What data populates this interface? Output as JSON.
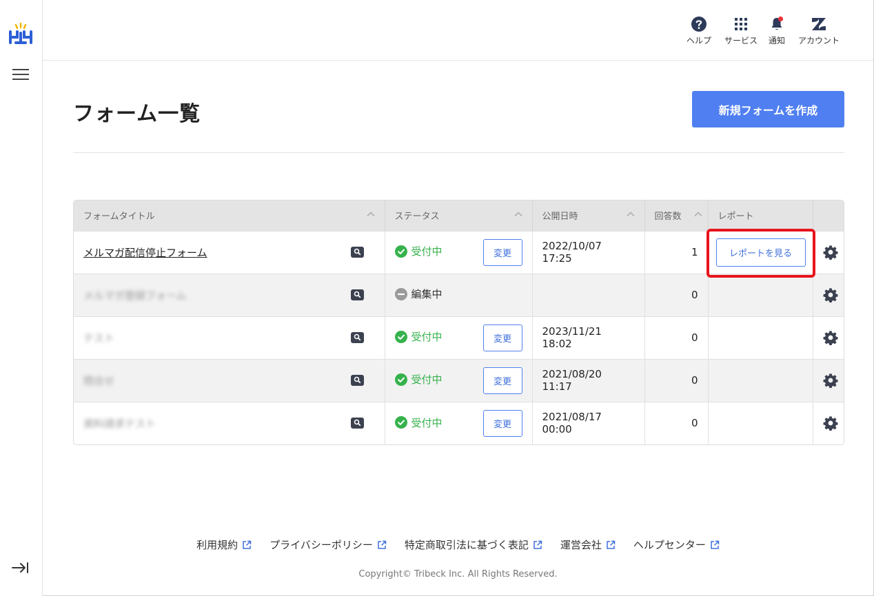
{
  "header": {
    "help_label": "ヘルプ",
    "service_label": "サービス",
    "notice_label": "通知",
    "account_label": "アカウント"
  },
  "page": {
    "title": "フォーム一覧",
    "create_button": "新規フォームを作成"
  },
  "table": {
    "columns": {
      "title": "フォームタイトル",
      "status": "ステータス",
      "published": "公開日時",
      "answers": "回答数",
      "report": "レポート"
    },
    "rows": [
      {
        "title": "メルマガ配信停止フォーム",
        "status": "受付中",
        "change": "変更",
        "published": "2022/10/07 17:25",
        "answers": "1",
        "report": "レポートを見る"
      },
      {
        "title": "メルマガ登録フォーム",
        "status": "編集中",
        "change": "",
        "published": "",
        "answers": "0",
        "report": ""
      },
      {
        "title": "テスト",
        "status": "受付中",
        "change": "変更",
        "published": "2023/11/21 18:02",
        "answers": "0",
        "report": ""
      },
      {
        "title": "問合せ",
        "status": "受付中",
        "change": "変更",
        "published": "2021/08/20 11:17",
        "answers": "0",
        "report": ""
      },
      {
        "title": "資料請求テスト",
        "status": "受付中",
        "change": "変更",
        "published": "2021/08/17 00:00",
        "answers": "0",
        "report": ""
      }
    ]
  },
  "footer": {
    "links": [
      "利用規約",
      "プライバシーポリシー",
      "特定商取引法に基づく表記",
      "運営会社",
      "ヘルプセンター"
    ],
    "copyright": "Copyright© Tribeck Inc. All Rights Reserved."
  },
  "colors": {
    "accent": "#4f7ff0",
    "status_on": "#36b24c",
    "highlight": "#e8141b"
  }
}
